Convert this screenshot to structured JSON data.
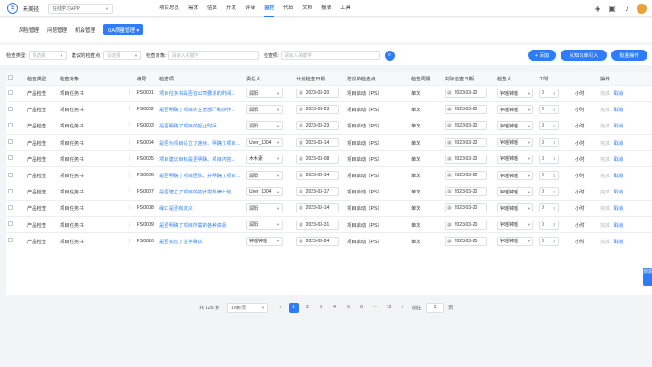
{
  "app": {
    "name": "禾美轻",
    "project_select": "在线学习APP"
  },
  "nav": [
    {
      "label": "项目总览",
      "active": false
    },
    {
      "label": "需求",
      "active": false
    },
    {
      "label": "估算",
      "active": false
    },
    {
      "label": "开发",
      "active": false
    },
    {
      "label": "评审",
      "active": false
    },
    {
      "label": "监控",
      "active": true
    },
    {
      "label": "代码",
      "active": false
    },
    {
      "label": "文档",
      "active": false
    },
    {
      "label": "报表",
      "active": false
    },
    {
      "label": "工具",
      "active": false
    }
  ],
  "subtabs": [
    {
      "label": "风险管理",
      "active": false
    },
    {
      "label": "问题管理",
      "active": false
    },
    {
      "label": "机会管理",
      "active": false
    },
    {
      "label": "QA质量管理",
      "active": true
    }
  ],
  "filters": {
    "type_label": "检查类型:",
    "type_placeholder": "请选择",
    "suggest_label": "建议的检查点:",
    "suggest_placeholder": "请选择",
    "object_label": "检查对象:",
    "object_placeholder": "请输入关键字",
    "item_label": "检查项:",
    "item_placeholder": "请输入关键字"
  },
  "actions": {
    "add": "+ 添加",
    "import": "从知识库引入",
    "batch": "批量操作"
  },
  "columns": [
    "检查类型",
    "检查对象",
    "编号",
    "检查项",
    "责任人",
    "计划检查日期",
    "建议的检查点",
    "检查周期",
    "实际检查日期",
    "检查人",
    "工时",
    "操作"
  ],
  "rows": [
    {
      "type": "产品检查",
      "object": "项目任务书",
      "code": "PS0001",
      "item": "项目任务书是否在公司要求的时间...",
      "owner": "润阳",
      "plan": "2023-03-20",
      "point": "项目启动（PS）",
      "cycle": "单次",
      "actual": "2023-03-20",
      "checker": "钟瑶钟瑶",
      "hours": "0",
      "unit": "小时",
      "op1": "完成",
      "op2": "取消"
    },
    {
      "type": "产品检查",
      "object": "项目任务书",
      "code": "PS0002",
      "item": "是否明确了项目的主管部门和协作...",
      "owner": "润阳",
      "plan": "2023-03-23",
      "point": "项目启动（PS）",
      "cycle": "单次",
      "actual": "2023-03-20",
      "checker": "钟瑶钟瑶",
      "hours": "0",
      "unit": "小时",
      "op1": "完成",
      "op2": "取消"
    },
    {
      "type": "产品检查",
      "object": "项目任务书",
      "code": "PS0003",
      "item": "是否明确了项目的起止时间",
      "owner": "润阳",
      "plan": "2023-03-23",
      "point": "项目启动（PS）",
      "cycle": "单次",
      "actual": "2023-03-20",
      "checker": "钟瑶钟瑶",
      "hours": "0",
      "unit": "小时",
      "op1": "完成",
      "op2": "取消"
    },
    {
      "type": "产品检查",
      "object": "项目任务书",
      "code": "PS0004",
      "item": "是否为项目设立了连续、明确了项目...",
      "owner": "User_1004",
      "plan": "2023-03-14",
      "point": "项目启动（PS）",
      "cycle": "单次",
      "actual": "2023-03-20",
      "checker": "钟瑶钟瑶",
      "hours": "0",
      "unit": "小时",
      "op1": "完成",
      "op2": "取消"
    },
    {
      "type": "产品检查",
      "object": "项目任务书",
      "code": "PS0005",
      "item": "项目建议目标是否明确、项目内容...",
      "owner": "木木素",
      "plan": "2023-03-08",
      "point": "项目启动（PS）",
      "cycle": "单次",
      "actual": "2023-03-20",
      "checker": "钟瑶钟瑶",
      "hours": "0",
      "unit": "小时",
      "op1": "完成",
      "op2": "取消"
    },
    {
      "type": "产品检查",
      "object": "项目任务书",
      "code": "PS0006",
      "item": "是否明确了项目团队、并明确了项目...",
      "owner": "润阳",
      "plan": "2023-03-14",
      "point": "项目启动（PS）",
      "cycle": "单次",
      "actual": "2023-03-20",
      "checker": "钟瑶钟瑶",
      "hours": "0",
      "unit": "小时",
      "op1": "完成",
      "op2": "取消"
    },
    {
      "type": "产品检查",
      "object": "项目任务书",
      "code": "PS0007",
      "item": "是否建立了项目的初步需规律计划...",
      "owner": "User_1004",
      "plan": "2023-03-17",
      "point": "项目启动（PS）",
      "cycle": "单次",
      "actual": "2023-03-20",
      "checker": "钟瑶钟瑶",
      "hours": "0",
      "unit": "小时",
      "op1": "完成",
      "op2": "取消"
    },
    {
      "type": "产品检查",
      "object": "项目任务书",
      "code": "PS0008",
      "item": "缘口是否有定义",
      "owner": "润阳",
      "plan": "2023-03-14",
      "point": "项目启动（PS）",
      "cycle": "单次",
      "actual": "2023-03-20",
      "checker": "钟瑶钟瑶",
      "hours": "0",
      "unit": "小时",
      "op1": "完成",
      "op2": "取消"
    },
    {
      "type": "产品检查",
      "object": "项目任务书",
      "code": "PS0009",
      "item": "是否明确了项目所需的各种资源",
      "owner": "润阳",
      "plan": "2023-03-31",
      "point": "项目启动（PS）",
      "cycle": "单次",
      "actual": "2023-03-20",
      "checker": "钟瑶钟瑶",
      "hours": "0",
      "unit": "小时",
      "op1": "完成",
      "op2": "取消"
    },
    {
      "type": "产品检查",
      "object": "项目任务书",
      "code": "PS0010",
      "item": "是否完成了签字确认",
      "owner": "钟瑶钟瑶",
      "plan": "2023-03-24",
      "point": "项目启动（PS）",
      "cycle": "单次",
      "actual": "2023-03-20",
      "checker": "钟瑶钟瑶",
      "hours": "0",
      "unit": "小时",
      "op1": "完成",
      "op2": "取消"
    }
  ],
  "pager": {
    "total": "共 125 条",
    "page_size": "10条/页",
    "pages": [
      "1",
      "2",
      "3",
      "4",
      "5",
      "6",
      "···",
      "13"
    ],
    "current": "1",
    "goto_label": "前往",
    "goto_value": "1",
    "page_suffix": "页",
    "prev": "‹",
    "next": "›"
  },
  "side_tab": "反馈"
}
